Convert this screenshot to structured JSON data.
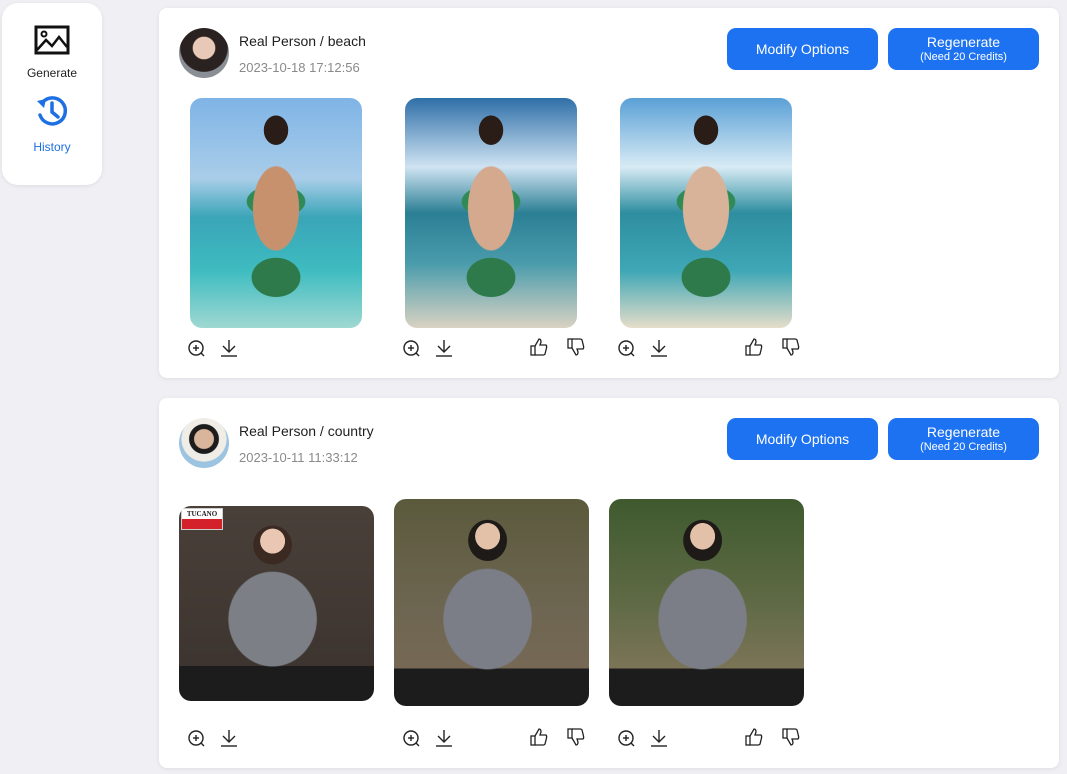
{
  "sidebar": {
    "items": [
      {
        "label": "Generate",
        "icon": "image-icon",
        "active": false
      },
      {
        "label": "History",
        "icon": "history-icon",
        "active": true
      }
    ],
    "active_color": "#1e6fe3"
  },
  "history": [
    {
      "title": "Real Person / beach",
      "timestamp": "2023-10-18 17:12:56",
      "modify_label": "Modify Options",
      "regenerate_label": "Regenerate",
      "regenerate_cost": "(Need 20 Credits)",
      "images": [
        {
          "alt": "original beach reference",
          "actions": [
            "zoom-in",
            "download"
          ]
        },
        {
          "alt": "generated beach result 1",
          "actions": [
            "zoom-in",
            "download",
            "thumbs-up",
            "thumbs-down"
          ]
        },
        {
          "alt": "generated beach result 2",
          "actions": [
            "zoom-in",
            "download",
            "thumbs-up",
            "thumbs-down"
          ]
        }
      ]
    },
    {
      "title": "Real Person / country",
      "timestamp": "2023-10-11 11:33:12",
      "modify_label": "Modify Options",
      "regenerate_label": "Regenerate",
      "regenerate_cost": "(Need 20 Credits)",
      "images": [
        {
          "alt": "original sweater reference",
          "brand_tag": "TUCANO",
          "actions": [
            "zoom-in",
            "download"
          ]
        },
        {
          "alt": "generated country result 1",
          "actions": [
            "zoom-in",
            "download",
            "thumbs-up",
            "thumbs-down"
          ]
        },
        {
          "alt": "generated country result 2",
          "actions": [
            "zoom-in",
            "download",
            "thumbs-up",
            "thumbs-down"
          ]
        }
      ]
    }
  ],
  "colors": {
    "primary_button": "#1d72f2",
    "background": "#efeff4",
    "timestamp": "#8a8a8a"
  }
}
